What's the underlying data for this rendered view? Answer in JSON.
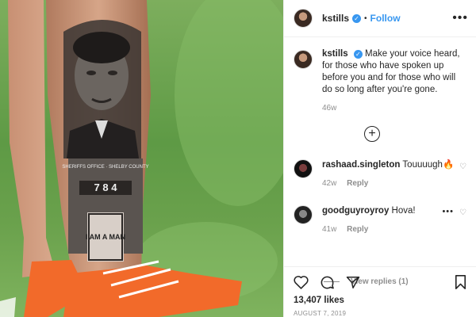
{
  "header": {
    "username": "kstills",
    "separator": "•",
    "follow_label": "Follow",
    "more_label": "•••"
  },
  "caption": {
    "username": "kstills",
    "text": "Make your voice heard, for those who have spoken up before you and for those who will do so long after you're gone.",
    "age": "46w"
  },
  "add_comment_label": "+",
  "comments": [
    {
      "username": "rashaad.singleton",
      "text": "Touuuugh🔥",
      "age": "42w",
      "reply_label": "Reply"
    },
    {
      "username": "goodguyroyroy",
      "text": "Hova!",
      "age": "41w",
      "reply_label": "Reply",
      "more_label": "•••",
      "view_replies": "View replies (1)"
    }
  ],
  "actions": {
    "likes": "13,407 likes",
    "date": "AUGUST 7, 2019"
  },
  "photo": {
    "tattoo_text_top": "SHERIFFS OFFICE · SHELBY COUNTY",
    "tattoo_text_number": "7 8 4",
    "tattoo_sign": "I AM A MAN"
  },
  "colors": {
    "accent": "#3897f0",
    "text": "#262626",
    "muted": "#8e8e8e",
    "border": "#efefef",
    "grass": "#6aa14c",
    "cleat": "#f26a2a"
  }
}
